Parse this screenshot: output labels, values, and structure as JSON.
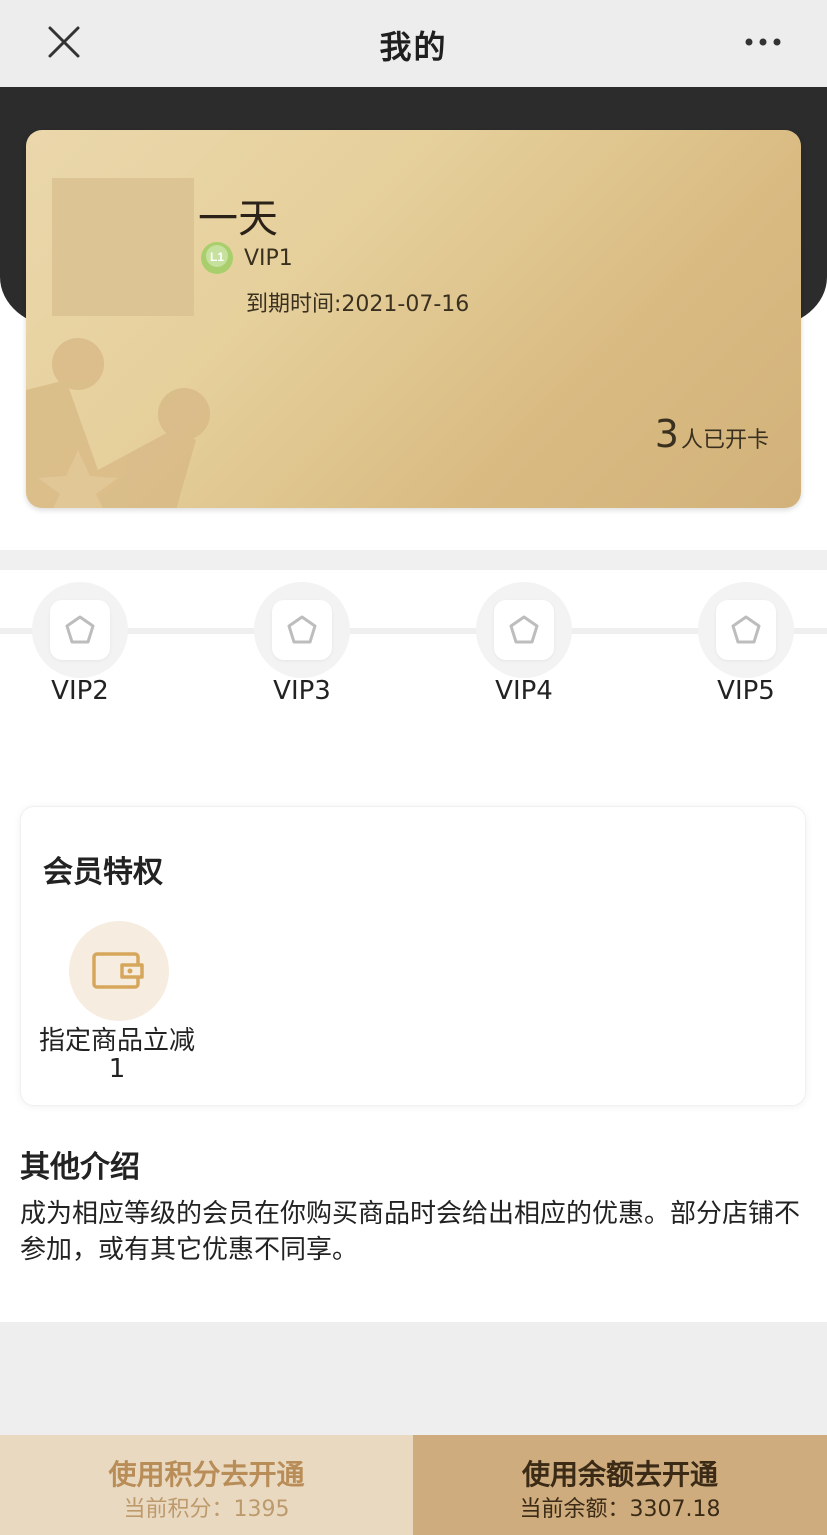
{
  "header": {
    "title": "我的",
    "close_icon": "close-icon",
    "more_icon": "more-icon"
  },
  "card": {
    "username": "一天",
    "level": "VIP1",
    "level_badge_text": "L1",
    "expire_text": "到期时间:2021-07-16",
    "opened_count": "3",
    "opened_label": "人已开卡",
    "colors": {
      "gold_light": "#ead7ab",
      "gold_dark": "#d2b27a"
    }
  },
  "levels": [
    {
      "label": "VIP2",
      "icon": "pentagon-icon"
    },
    {
      "label": "VIP3",
      "icon": "pentagon-icon"
    },
    {
      "label": "VIP4",
      "icon": "pentagon-icon"
    },
    {
      "label": "VIP5",
      "icon": "pentagon-icon"
    }
  ],
  "privileges": {
    "title": "会员特权",
    "items": [
      {
        "label": "指定商品立减1",
        "icon": "wallet-icon"
      }
    ]
  },
  "intro": {
    "title": "其他介绍",
    "body": "成为相应等级的会员在你购买商品时会给出相应的优惠。部分店铺不参加，或有其它优惠不同享。"
  },
  "actions": {
    "points": {
      "label": "使用积分去开通",
      "sub": "当前积分：1395"
    },
    "balance": {
      "label": "使用余额去开通",
      "sub": "当前余额：3307.18"
    }
  }
}
